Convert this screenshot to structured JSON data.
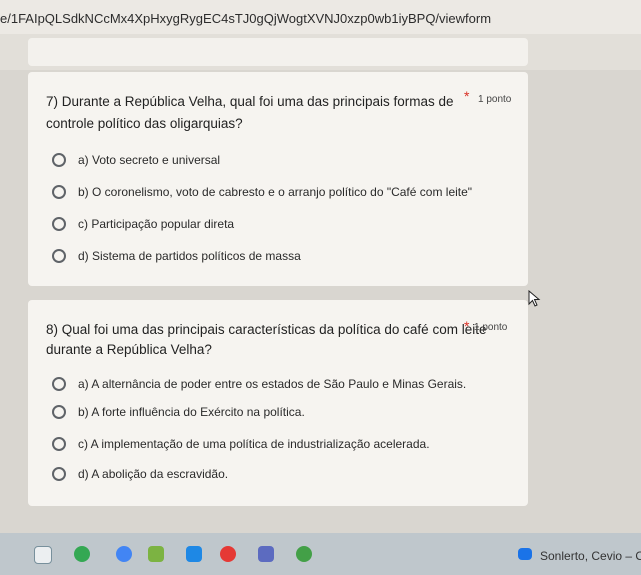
{
  "browser": {
    "url": "e/1FAIpQLSdkNCcMx4XpHxygRygEC4sTJ0gQjWogtXVNJ0xzp0wb1iyBPQ/viewform"
  },
  "questions": [
    {
      "title_line1": "7) Durante a República Velha, qual foi uma das principais formas de",
      "title_line2": "controle político das oligarquias?",
      "required_mark": "*",
      "points": "1 ponto",
      "options": [
        "a) Voto secreto e universal",
        "b) O coronelismo, voto de cabresto e o arranjo político do \"Café com leite\"",
        "c) Participação popular direta",
        "d) Sistema de partidos políticos de massa"
      ]
    },
    {
      "title_line1": "8) Qual foi uma das principais características da política do café com leite",
      "title_line2": "durante a República Velha?",
      "required_mark": "*",
      "points": "1 ponto",
      "options": [
        "a) A alternância de poder entre os estados de São Paulo e Minas Gerais.",
        "b) A forte influência do Exército na política.",
        "c) A implementação de uma política de industrialização acelerada.",
        "d) A abolição da escravidão."
      ]
    }
  ],
  "taskbar": {
    "media_text": "Sonlerto, Cevio – O",
    "icons": [
      "files-icon",
      "chrome-icon",
      "folder-icon",
      "docs-icon",
      "play-store-icon",
      "youtube-icon",
      "camera-icon",
      "chrome-alt-icon",
      "play-icon"
    ],
    "colors": {
      "chrome": "#4285f4",
      "youtube": "#e53935",
      "play": "#1a73e8"
    }
  }
}
